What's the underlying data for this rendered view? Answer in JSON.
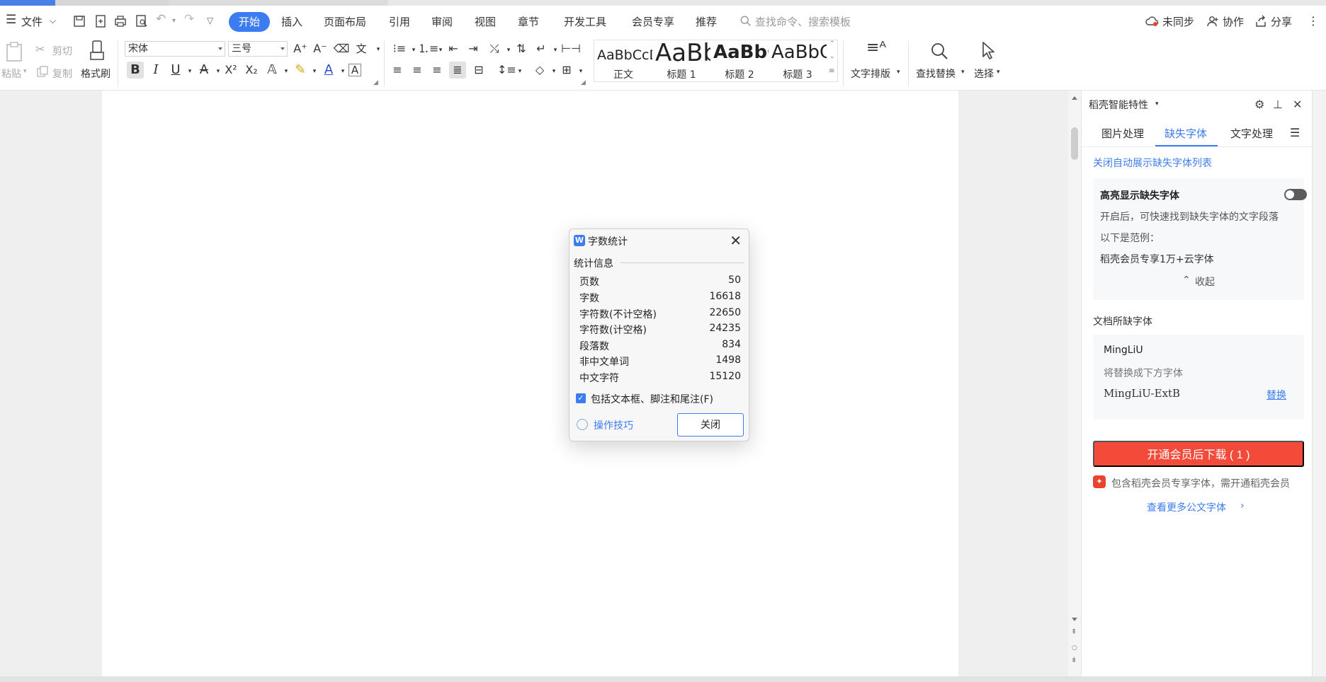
{
  "menubar": {
    "file_label": "文件",
    "tabs": [
      "开始",
      "插入",
      "页面布局",
      "引用",
      "审阅",
      "视图",
      "章节",
      "开发工具",
      "会员专享",
      "推荐"
    ],
    "search_placeholder": "查找命令、搜索模板",
    "sync_label": "未同步",
    "collab_label": "协作",
    "share_label": "分享"
  },
  "ribbon": {
    "paste_label": "粘贴",
    "cut_label": "剪切",
    "copy_label": "复制",
    "format_painter_label": "格式刷",
    "font_name": "宋体",
    "font_size": "三号",
    "styles": [
      {
        "sample": "AaBbCcDd",
        "name": "正文"
      },
      {
        "sample": "AaBb",
        "name": "标题 1"
      },
      {
        "sample": "AaBbC",
        "name": "标题 2"
      },
      {
        "sample": "AaBbC",
        "name": "标题 3"
      }
    ],
    "text_layout_label": "文字排版",
    "find_replace_label": "查找替换",
    "select_label": "选择"
  },
  "dialog": {
    "title": "字数统计",
    "group_label": "统计信息",
    "stats": [
      {
        "label": "页数",
        "value": "50"
      },
      {
        "label": "字数",
        "value": "16618"
      },
      {
        "label": "字符数(不计空格)",
        "value": "22650"
      },
      {
        "label": "字符数(计空格)",
        "value": "24235"
      },
      {
        "label": "段落数",
        "value": "834"
      },
      {
        "label": "非中文单词",
        "value": "1498"
      },
      {
        "label": "中文字符",
        "value": "15120"
      }
    ],
    "checkbox_label": "包括文本框、脚注和尾注(F)",
    "tips_label": "操作技巧",
    "close_button": "关闭"
  },
  "panel": {
    "title": "稻壳智能特性",
    "tabs": [
      "图片处理",
      "缺失字体",
      "文字处理"
    ],
    "close_auto_link": "关闭自动展示缺失字体列表",
    "highlight_title": "高亮显示缺失字体",
    "highlight_desc": "开启后，可快速找到缺失字体的文字段落",
    "example_label": "以下是范例：",
    "example_text": "稻壳会员专享1万+云字体",
    "collapse_label": "收起",
    "missing_fonts_title": "文档所缺字体",
    "missing_font": "MingLiU",
    "replace_hint": "将替换成下方字体",
    "replacement_font": "MingLiU-ExtB",
    "replace_link": "替换",
    "cta_label": "开通会员后下载 ( 1 )",
    "member_note": "包含稻壳会员专享字体，需开通稻壳会员",
    "more_fonts_link": "查看更多公文字体"
  },
  "colors": {
    "accent": "#3b7df0",
    "cta": "#f34b3a"
  }
}
